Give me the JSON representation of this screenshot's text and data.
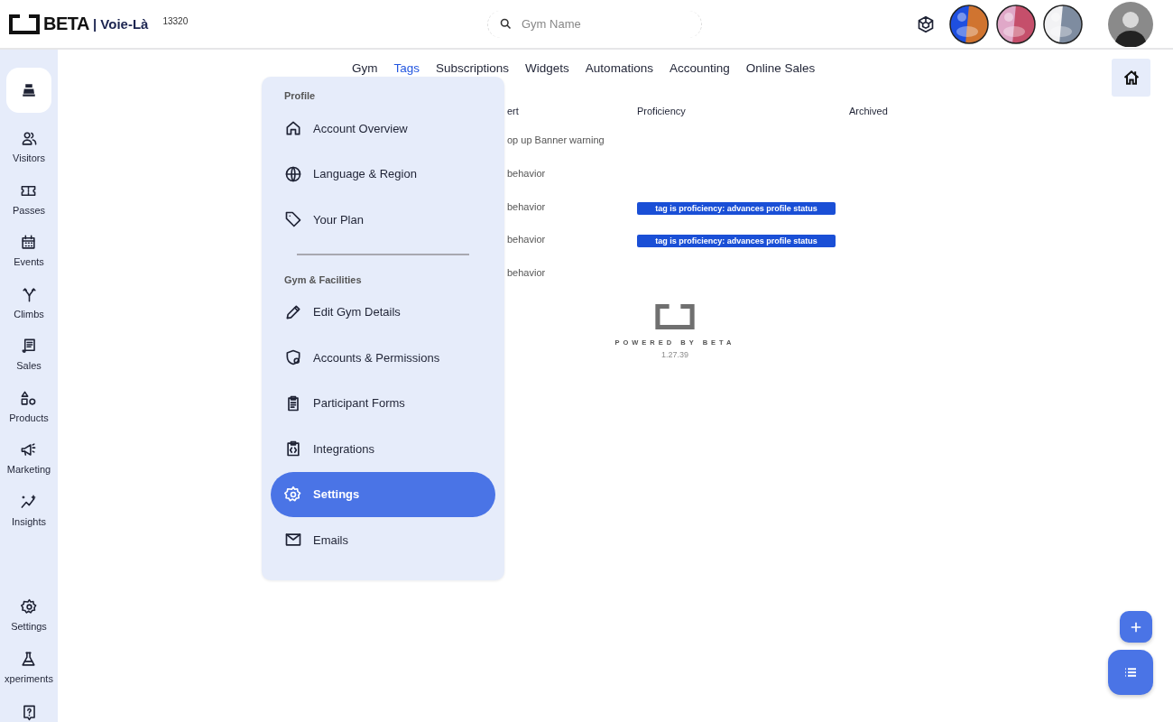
{
  "header": {
    "brand": "BETA",
    "gym": "| Voie-Là",
    "gym_id": "13320",
    "search": {
      "placeholder": "Gym Name"
    }
  },
  "sidebar": {
    "items": [
      {
        "label": "Visitors"
      },
      {
        "label": "Passes"
      },
      {
        "label": "Events"
      },
      {
        "label": "Climbs"
      },
      {
        "label": "Sales"
      },
      {
        "label": "Products"
      },
      {
        "label": "Marketing"
      },
      {
        "label": "Insights"
      }
    ],
    "bottom_items": [
      {
        "label": "Settings"
      },
      {
        "label": "xperiments"
      }
    ]
  },
  "tabs": [
    {
      "label": "Gym",
      "selected": false
    },
    {
      "label": "Tags",
      "selected": true
    },
    {
      "label": "Subscriptions",
      "selected": false
    },
    {
      "label": "Widgets",
      "selected": false
    },
    {
      "label": "Automations",
      "selected": false
    },
    {
      "label": "Accounting",
      "selected": false
    },
    {
      "label": "Online Sales",
      "selected": false
    }
  ],
  "table": {
    "columns": [
      "ert",
      "Proficiency",
      "Archived"
    ],
    "rows": [
      {
        "column_1": "op up Banner warning"
      },
      {
        "column_1": "behavior"
      },
      {
        "column_1": "behavior",
        "proficiency": "tag is proficiency: advances profile status"
      },
      {
        "column_1": "behavior",
        "proficiency": "tag is proficiency: advances profile status"
      },
      {
        "column_1": "behavior"
      }
    ]
  },
  "footer": {
    "powered": "POWERED BY BETA",
    "version": "1.27.39"
  },
  "menu": {
    "sections": [
      {
        "title": "Profile",
        "items": [
          {
            "label": "Account Overview",
            "selected": false
          },
          {
            "label": "Language & Region",
            "selected": false
          },
          {
            "label": "Your Plan",
            "selected": false
          }
        ]
      },
      {
        "title": "Gym & Facilities",
        "items": [
          {
            "label": "Edit Gym Details",
            "selected": false
          },
          {
            "label": "Accounts & Permissions",
            "selected": false
          },
          {
            "label": "Participant Forms",
            "selected": false
          },
          {
            "label": "Integrations",
            "selected": false
          },
          {
            "label": "Settings",
            "selected": true
          },
          {
            "label": "Emails",
            "selected": false
          }
        ]
      }
    ]
  }
}
